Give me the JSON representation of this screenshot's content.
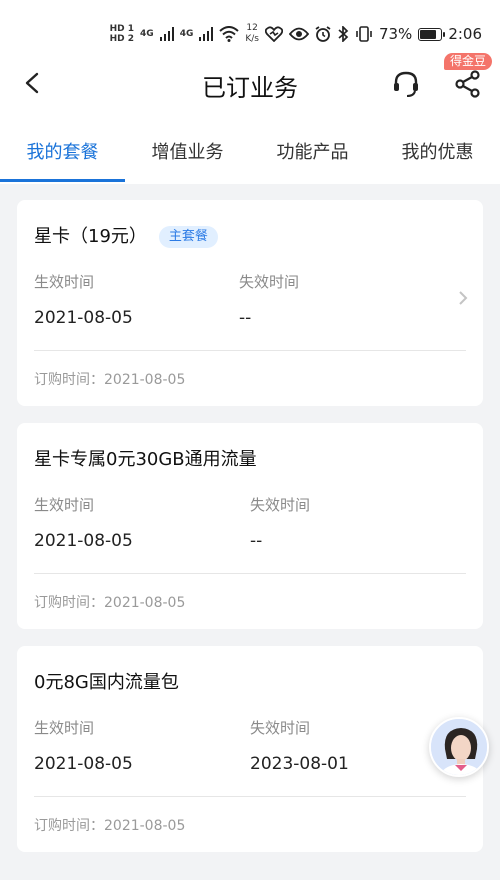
{
  "status_bar": {
    "hd1": "HD 1",
    "hd2": "HD 2",
    "net1": "4G",
    "net2": "4G",
    "speed_value": "12",
    "speed_unit": "K/s",
    "battery": "73%",
    "battery_level": 0.73,
    "time": "2:06"
  },
  "header": {
    "title": "已订业务",
    "reward_badge": "得金豆"
  },
  "tabs": [
    {
      "label": "我的套餐",
      "active": true
    },
    {
      "label": "增值业务",
      "active": false
    },
    {
      "label": "功能产品",
      "active": false
    },
    {
      "label": "我的优惠",
      "active": false
    }
  ],
  "cards": [
    {
      "name": "星卡（19元）",
      "badge": "主套餐",
      "effective_label": "生效时间",
      "expire_label": "失效时间",
      "effective_date": "2021-08-05",
      "expire_date": "--",
      "order_label": "订购时间：",
      "order_date": "2021-08-05"
    },
    {
      "name": "星卡专属0元30GB通用流量",
      "effective_label": "生效时间",
      "expire_label": "失效时间",
      "effective_date": "2021-08-05",
      "expire_date": "--",
      "order_label": "订购时间：",
      "order_date": "2021-08-05"
    },
    {
      "name": "0元8G国内流量包",
      "effective_label": "生效时间",
      "expire_label": "失效时间",
      "effective_date": "2021-08-05",
      "expire_date": "2023-08-01",
      "order_label": "订购时间：",
      "order_date": "2021-08-05"
    }
  ],
  "colors": {
    "accent": "#1a73d9",
    "badge_bg": "#e1efff",
    "reward": "#f4746a",
    "page_bg": "#f2f3f5"
  }
}
